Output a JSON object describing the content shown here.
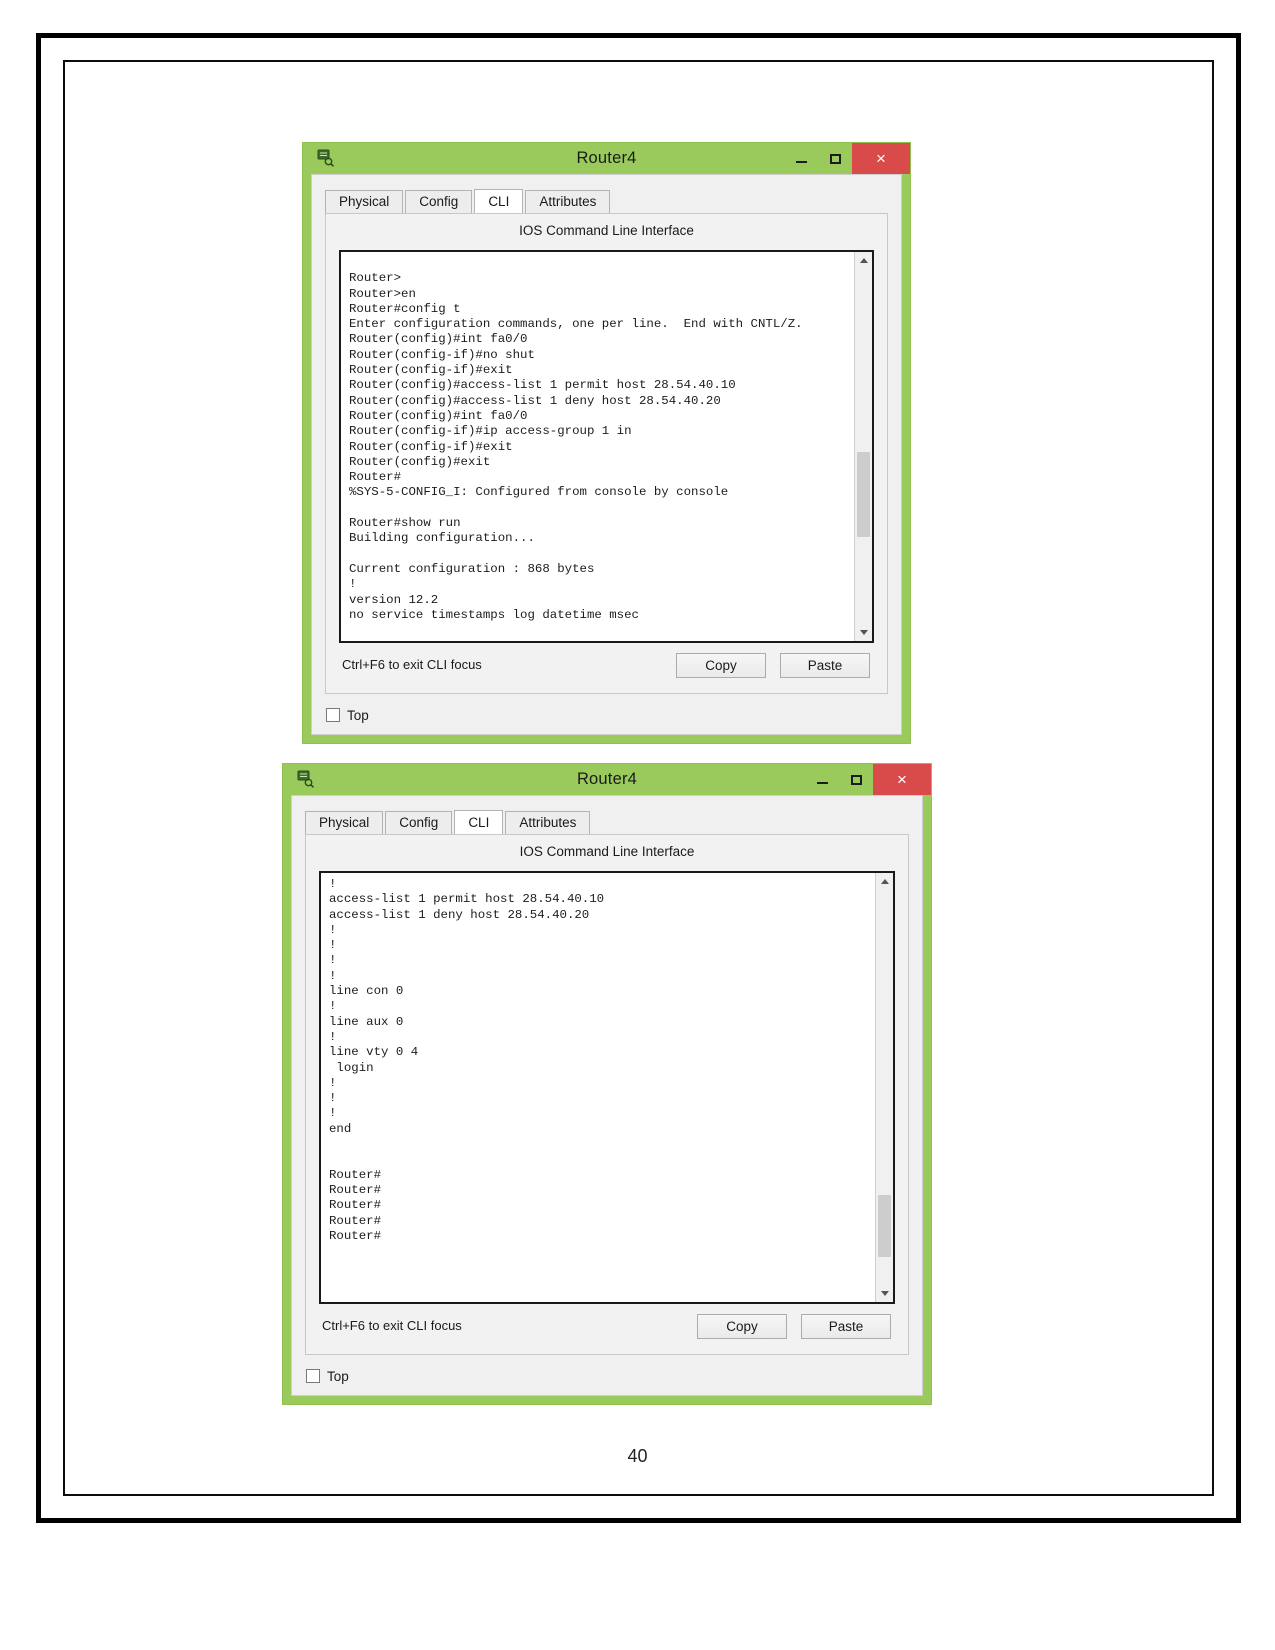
{
  "document": {
    "page_number": "40"
  },
  "colors": {
    "window_chrome_green": "#9ACA5C",
    "close_button_red": "#D94B4B",
    "panel_gray": "#F0F0F0",
    "cli_background": "#FFFFFF",
    "cli_text": "#1C1C1C"
  },
  "windows": [
    {
      "id": "router4-window-top",
      "title": "Router4",
      "title_icon": "router-device-icon",
      "window_buttons": {
        "minimize": "–",
        "maximize": "□",
        "close": "×"
      },
      "tabs": [
        {
          "label": "Physical",
          "active": false
        },
        {
          "label": "Config",
          "active": false
        },
        {
          "label": "CLI",
          "active": true
        },
        {
          "label": "Attributes",
          "active": false
        }
      ],
      "panel_title": "IOS Command Line Interface",
      "cli_text": "\nRouter>\nRouter>en\nRouter#config t\nEnter configuration commands, one per line.  End with CNTL/Z.\nRouter(config)#int fa0/0\nRouter(config-if)#no shut\nRouter(config-if)#exit\nRouter(config)#access-list 1 permit host 28.54.40.10\nRouter(config)#access-list 1 deny host 28.54.40.20\nRouter(config)#int fa0/0\nRouter(config-if)#ip access-group 1 in\nRouter(config-if)#exit\nRouter(config)#exit\nRouter#\n%SYS-5-CONFIG_I: Configured from console by console\n\nRouter#show run\nBuilding configuration...\n\nCurrent configuration : 868 bytes\n!\nversion 12.2\nno service timestamps log datetime msec",
      "hint": "Ctrl+F6 to exit CLI focus",
      "copy_label": "Copy",
      "paste_label": "Paste",
      "top_checkbox_label": "Top",
      "top_checkbox_checked": false,
      "scrollbar": {
        "up_arrow": "▲",
        "down_arrow": "▼",
        "thumb_position_pct": 57
      }
    },
    {
      "id": "router4-window-bottom",
      "title": "Router4",
      "title_icon": "router-device-icon",
      "window_buttons": {
        "minimize": "–",
        "maximize": "□",
        "close": "×"
      },
      "tabs": [
        {
          "label": "Physical",
          "active": false
        },
        {
          "label": "Config",
          "active": false
        },
        {
          "label": "CLI",
          "active": true
        },
        {
          "label": "Attributes",
          "active": false
        }
      ],
      "panel_title": "IOS Command Line Interface",
      "cli_text": "!\naccess-list 1 permit host 28.54.40.10\naccess-list 1 deny host 28.54.40.20\n!\n!\n!\n!\nline con 0\n!\nline aux 0\n!\nline vty 0 4\n login\n!\n!\n!\nend\n\n\nRouter#\nRouter#\nRouter#\nRouter#\nRouter#",
      "hint": "Ctrl+F6 to exit CLI focus",
      "copy_label": "Copy",
      "paste_label": "Paste",
      "top_checkbox_label": "Top",
      "top_checkbox_checked": false,
      "scrollbar": {
        "up_arrow": "▲",
        "down_arrow": "▼",
        "thumb_position_pct": 83
      }
    }
  ]
}
